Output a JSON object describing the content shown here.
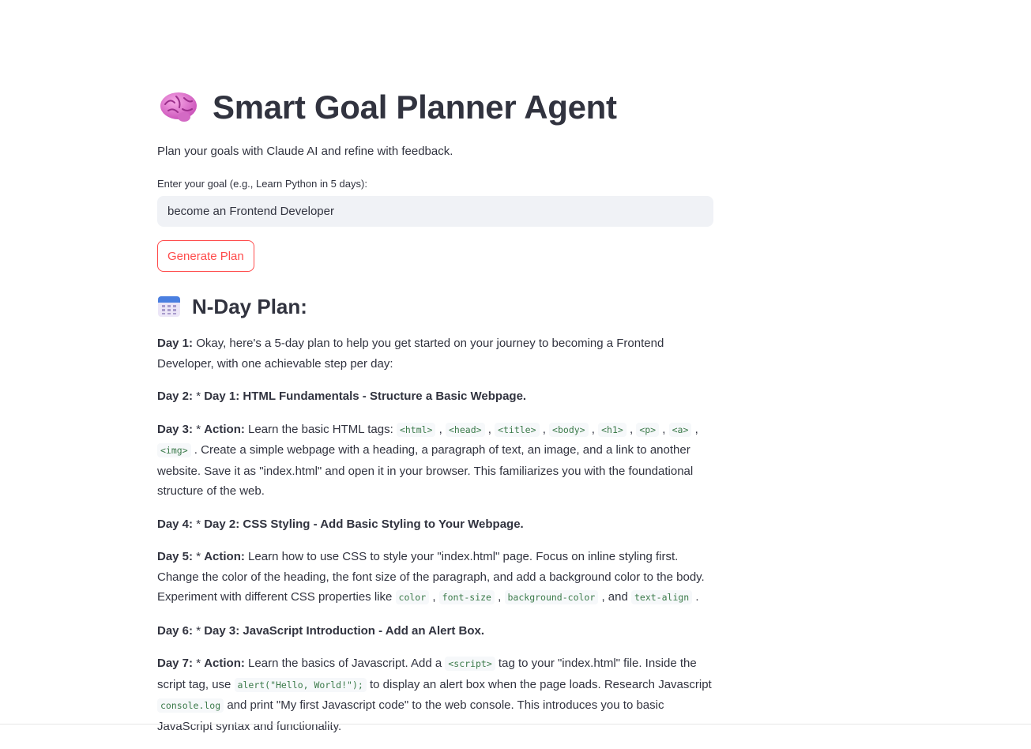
{
  "header": {
    "title": "Smart Goal Planner Agent",
    "icon": "brain-icon"
  },
  "subtitle": "Plan your goals with Claude AI and refine with feedback.",
  "goal_input": {
    "label": "Enter your goal (e.g., Learn Python in 5 days):",
    "value": "become an Frontend Developer"
  },
  "generate_button": {
    "label": "Generate Plan"
  },
  "plan": {
    "heading": "N-Day Plan:",
    "icon": "calendar-icon",
    "days": [
      {
        "label": "Day 1:",
        "parts": [
          {
            "t": "text",
            "v": " Okay, here's a 5-day plan to help you get started on your journey to becoming a Frontend Developer, with one achievable step per day:"
          }
        ]
      },
      {
        "label": "Day 2:",
        "parts": [
          {
            "t": "text",
            "v": " * "
          },
          {
            "t": "bold",
            "v": "Day 1: HTML Fundamentals - Structure a Basic Webpage."
          }
        ]
      },
      {
        "label": "Day 3:",
        "parts": [
          {
            "t": "text",
            "v": " * "
          },
          {
            "t": "bold",
            "v": "Action:"
          },
          {
            "t": "text",
            "v": " Learn the basic HTML tags: "
          },
          {
            "t": "code",
            "v": "<html>"
          },
          {
            "t": "text",
            "v": " , "
          },
          {
            "t": "code",
            "v": "<head>"
          },
          {
            "t": "text",
            "v": " , "
          },
          {
            "t": "code",
            "v": "<title>"
          },
          {
            "t": "text",
            "v": " , "
          },
          {
            "t": "code",
            "v": "<body>"
          },
          {
            "t": "text",
            "v": " , "
          },
          {
            "t": "code",
            "v": "<h1>"
          },
          {
            "t": "text",
            "v": " , "
          },
          {
            "t": "code",
            "v": "<p>"
          },
          {
            "t": "text",
            "v": " , "
          },
          {
            "t": "code",
            "v": "<a>"
          },
          {
            "t": "text",
            "v": " , "
          },
          {
            "t": "code",
            "v": "<img>"
          },
          {
            "t": "text",
            "v": " . Create a simple webpage with a heading, a paragraph of text, an image, and a link to another website. Save it as \"index.html\" and open it in your browser. This familiarizes you with the foundational structure of the web."
          }
        ]
      },
      {
        "label": "Day 4:",
        "parts": [
          {
            "t": "text",
            "v": " * "
          },
          {
            "t": "bold",
            "v": "Day 2: CSS Styling - Add Basic Styling to Your Webpage."
          }
        ]
      },
      {
        "label": "Day 5:",
        "parts": [
          {
            "t": "text",
            "v": " * "
          },
          {
            "t": "bold",
            "v": "Action:"
          },
          {
            "t": "text",
            "v": " Learn how to use CSS to style your \"index.html\" page. Focus on inline styling first. Change the color of the heading, the font size of the paragraph, and add a background color to the body. Experiment with different CSS properties like "
          },
          {
            "t": "code",
            "v": "color"
          },
          {
            "t": "text",
            "v": " , "
          },
          {
            "t": "code",
            "v": "font-size"
          },
          {
            "t": "text",
            "v": " , "
          },
          {
            "t": "code",
            "v": "background-color"
          },
          {
            "t": "text",
            "v": " , and "
          },
          {
            "t": "code",
            "v": "text-align"
          },
          {
            "t": "text",
            "v": " ."
          }
        ]
      },
      {
        "label": "Day 6:",
        "parts": [
          {
            "t": "text",
            "v": " * "
          },
          {
            "t": "bold",
            "v": "Day 3: JavaScript Introduction - Add an Alert Box."
          }
        ]
      },
      {
        "label": "Day 7:",
        "parts": [
          {
            "t": "text",
            "v": " * "
          },
          {
            "t": "bold",
            "v": "Action:"
          },
          {
            "t": "text",
            "v": " Learn the basics of Javascript. Add a "
          },
          {
            "t": "code",
            "v": "<script>"
          },
          {
            "t": "text",
            "v": " tag to your \"index.html\" file. Inside the script tag, use "
          },
          {
            "t": "code",
            "v": "alert(\"Hello, World!\");"
          },
          {
            "t": "text",
            "v": " to display an alert box when the page loads. Research Javascript "
          },
          {
            "t": "code",
            "v": "console.log"
          },
          {
            "t": "text",
            "v": " and print \"My first Javascript code\" to the web console. This introduces you to basic JavaScript syntax and functionality."
          }
        ]
      }
    ]
  }
}
